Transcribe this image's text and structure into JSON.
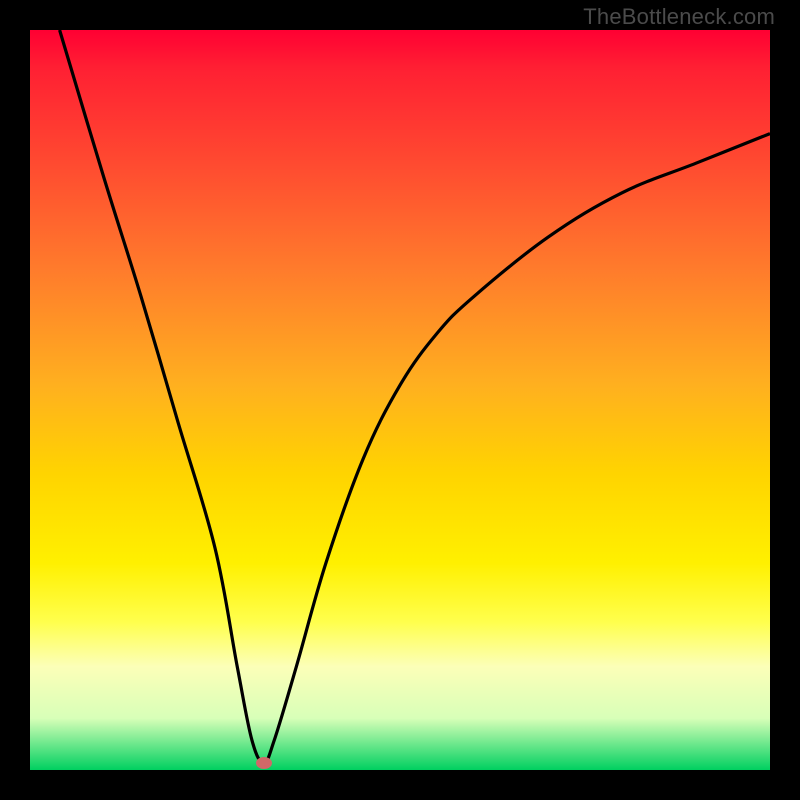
{
  "watermark": "TheBottleneck.com",
  "colors": {
    "frame": "#000000",
    "curve": "#000000",
    "marker": "#d06868",
    "gradient_top": "#ff0033",
    "gradient_bottom": "#00d060"
  },
  "chart_data": {
    "type": "line",
    "title": "",
    "xlabel": "",
    "ylabel": "",
    "xlim": [
      0,
      100
    ],
    "ylim": [
      0,
      100
    ],
    "series": [
      {
        "name": "bottleneck-curve",
        "x_estimated": [
          4,
          10,
          15,
          20,
          25,
          28,
          30,
          31.6,
          33,
          36,
          40,
          45,
          50,
          55,
          60,
          70,
          80,
          90,
          100
        ],
        "y_estimated": [
          100,
          80,
          64,
          47,
          30,
          14,
          4,
          1,
          4,
          14,
          28,
          42,
          52,
          59,
          64,
          72,
          78,
          82,
          86
        ]
      }
    ],
    "marker": {
      "x_estimated": 31.6,
      "y_estimated": 1
    },
    "grid": false
  }
}
